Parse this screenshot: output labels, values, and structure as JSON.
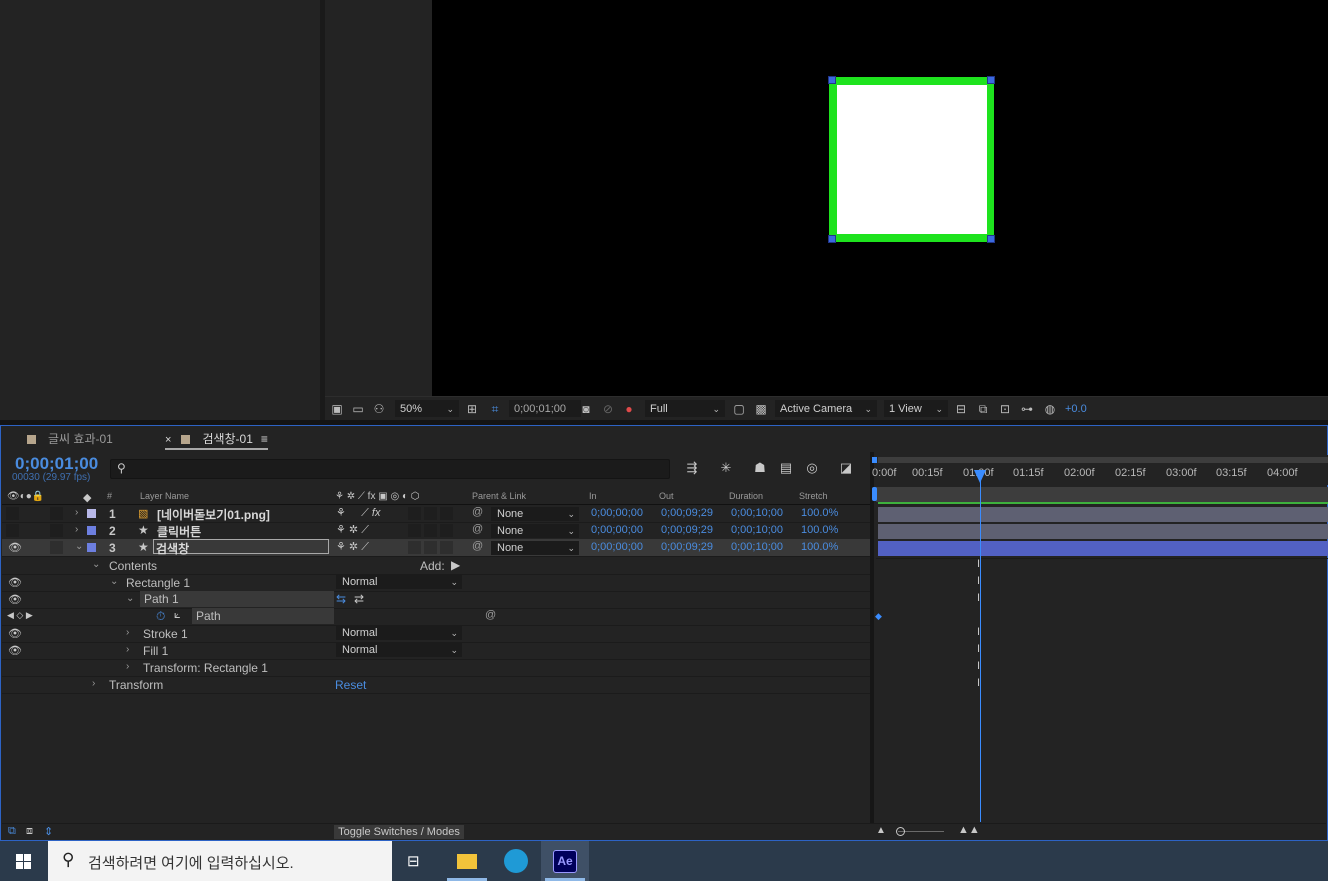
{
  "viewer": {
    "zoom": "50%",
    "timecode": "0;00;01;00",
    "resolution": "Full",
    "camera": "Active Camera",
    "views": "1 View",
    "exposure": "+0.0"
  },
  "comp_tabs": [
    {
      "label": "글씨 효과-01",
      "active": false
    },
    {
      "label": "검색창-01",
      "active": true
    }
  ],
  "timeline": {
    "timecode": "0;00;01;00",
    "fps": "00030 (29.97 fps)",
    "search_placeholder": "",
    "headers": {
      "source": "#",
      "layer_name": "Layer Name",
      "parent": "Parent & Link",
      "in": "In",
      "out": "Out",
      "duration": "Duration",
      "stretch": "Stretch"
    },
    "layers": [
      {
        "num": "1",
        "name": "[네이버돋보기01.png]",
        "parent": "None",
        "in": "0;00;00;00",
        "out": "0;00;09;29",
        "duration": "0;00;10;00",
        "stretch": "100.0%",
        "color": "#b8b8e8"
      },
      {
        "num": "2",
        "name": "클릭버튼",
        "parent": "None",
        "in": "0;00;00;00",
        "out": "0;00;09;29",
        "duration": "0;00;10;00",
        "stretch": "100.0%",
        "color": "#6d7fe0"
      },
      {
        "num": "3",
        "name": "검색창",
        "parent": "None",
        "in": "0;00;00;00",
        "out": "0;00;09;29",
        "duration": "0;00;10;00",
        "stretch": "100.0%",
        "color": "#6d7fe0"
      }
    ],
    "properties": {
      "contents": "Contents",
      "add": "Add:",
      "rectangle": "Rectangle 1",
      "rectangle_mode": "Normal",
      "path_group": "Path 1",
      "path": "Path",
      "stroke": "Stroke 1",
      "stroke_mode": "Normal",
      "fill": "Fill 1",
      "fill_mode": "Normal",
      "transform_rect": "Transform: Rectangle 1",
      "transform": "Transform",
      "reset": "Reset"
    },
    "ruler": [
      "0:00f",
      "00:15f",
      "01:00f",
      "01:15f",
      "02:00f",
      "02:15f",
      "03:00f",
      "03:15f",
      "04:00f"
    ],
    "toggle_label": "Toggle Switches / Modes"
  },
  "taskbar": {
    "search_placeholder": "검색하려면 여기에 입력하십시오.",
    "ae_label": "Ae"
  },
  "colors": {
    "accent": "#4a8cdf",
    "shape_stroke": "#1ee31e",
    "cti": "#3a8cff"
  }
}
